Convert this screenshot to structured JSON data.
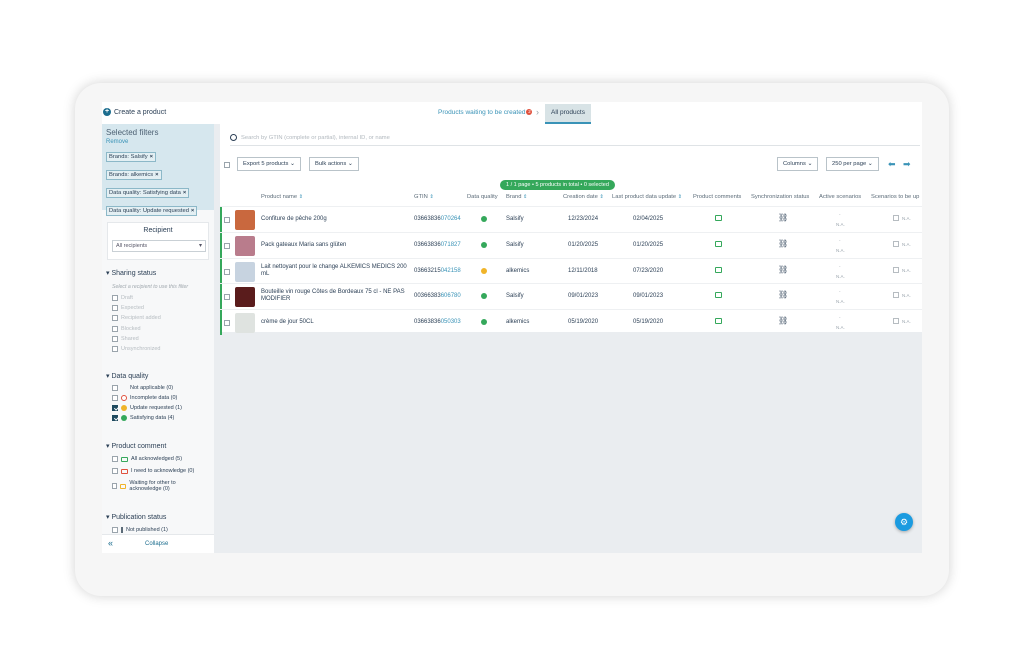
{
  "topbar": {
    "create_label": "Create a product",
    "tab_waiting": "Products waiting to be created",
    "tab_waiting_badge": "2",
    "tab_all": "All products"
  },
  "filters": {
    "title": "Selected filters",
    "remove": "Remove",
    "chips": [
      "Brands: Salsify",
      "Brands: alkemics",
      "Data quality: Satisfying data",
      "Data quality: Update requested"
    ]
  },
  "recipient": {
    "title": "Recipient",
    "placeholder": "All recipients"
  },
  "sharing_status": {
    "title": "Sharing status",
    "hint": "Select a recipient to use this filter",
    "options": [
      "Draft",
      "Expected",
      "Recipient added",
      "Blocked",
      "Shared",
      "Unsynchronized"
    ]
  },
  "data_quality": {
    "title": "Data quality",
    "options": [
      {
        "label": "Not applicable (0)",
        "checked": false,
        "color": ""
      },
      {
        "label": "Incomplete data (0)",
        "checked": false,
        "color": "#e0503c"
      },
      {
        "label": "Update requested (1)",
        "checked": true,
        "color": "#f0b429"
      },
      {
        "label": "Satisfying data (4)",
        "checked": true,
        "color": "#35a85b"
      }
    ]
  },
  "product_comment": {
    "title": "Product comment",
    "options": [
      {
        "label": "All acknowledged (5)",
        "color": "#35a85b"
      },
      {
        "label": "I need to acknowledge (0)",
        "color": "#e0503c"
      },
      {
        "label": "Waiting for other to acknowledge (0)",
        "color": "#f0b429"
      }
    ]
  },
  "publication_status": {
    "title": "Publication status",
    "options": [
      "Not published (1)"
    ]
  },
  "sidebar_footer": {
    "collapse": "Collapse"
  },
  "search": {
    "placeholder": "Search by GTIN (complete or partial), internal ID, or name"
  },
  "toolbar": {
    "export": "Export 5 products",
    "bulk": "Bulk actions",
    "columns": "Columns",
    "per_page": "250 per page"
  },
  "pagination_pill": "1 / 1 page  •  5 products in total  •  0 selected",
  "table": {
    "headers": {
      "name": "Product name",
      "gtin": "GTIN",
      "quality": "Data quality",
      "brand": "Brand",
      "creation": "Creation date",
      "last_update": "Last product data update",
      "comments": "Product comments",
      "sync": "Synchronization status",
      "scenarios": "Active scenarios",
      "to_be": "Scenarios to be up"
    },
    "na": "N.A.",
    "dash": "-",
    "rows": [
      {
        "name": "Confiture de pêche 200g",
        "gtin_a": "03663836",
        "gtin_b": "070264",
        "quality_color": "#35a85b",
        "brand": "Salsify",
        "created": "12/23/2024",
        "updated": "02/04/2025",
        "thumb": "#c9683e"
      },
      {
        "name": "Pack gateaux Maria sans glüten",
        "gtin_a": "03663836",
        "gtin_b": "071827",
        "quality_color": "#35a85b",
        "brand": "Salsify",
        "created": "01/20/2025",
        "updated": "01/20/2025",
        "thumb": "#b97c8c"
      },
      {
        "name": "Lait nettoyant pour le change ALKEMICS MEDICS 200 mL",
        "gtin_a": "03663215",
        "gtin_b": "042158",
        "quality_color": "#f0b429",
        "brand": "alkemics",
        "created": "12/11/2018",
        "updated": "07/23/2020",
        "thumb": "#c7d3e0"
      },
      {
        "name": "Bouteille vin rouge Côtes de Bordeaux 75 cl - NE PAS MODIFIER",
        "gtin_a": "00366383",
        "gtin_b": "606780",
        "quality_color": "#35a85b",
        "brand": "Salsify",
        "created": "09/01/2023",
        "updated": "09/01/2023",
        "thumb": "#5a1c1c"
      },
      {
        "name": "crème de jour 50CL",
        "gtin_a": "03663836",
        "gtin_b": "050303",
        "quality_color": "#35a85b",
        "brand": "alkemics",
        "created": "05/19/2020",
        "updated": "05/19/2020",
        "thumb": "#dfe3e0"
      }
    ]
  },
  "icons": {
    "search": "search-icon",
    "collapse": "double-chevron-left-icon",
    "prev": "arrow-left-icon",
    "next": "arrow-right-icon",
    "fab": "settings-icon"
  }
}
